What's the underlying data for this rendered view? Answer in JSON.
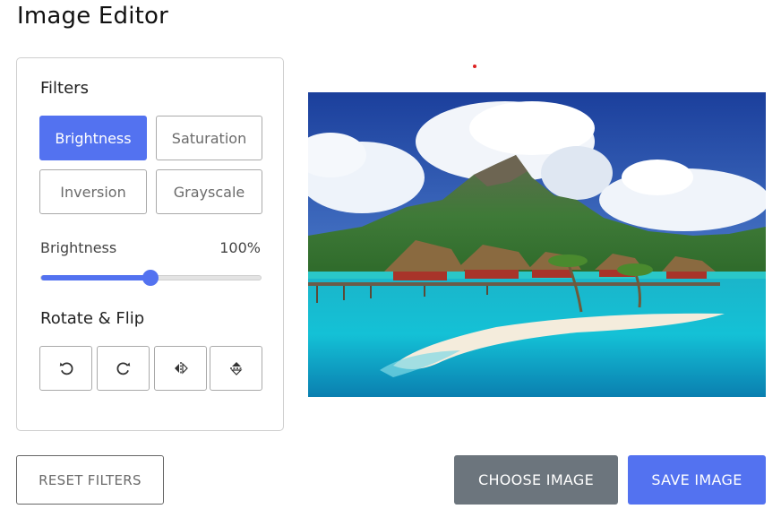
{
  "app": {
    "title": "Image Editor"
  },
  "filters": {
    "heading": "Filters",
    "buttons": [
      {
        "label": "Brightness",
        "active": true
      },
      {
        "label": "Saturation",
        "active": false
      },
      {
        "label": "Inversion",
        "active": false
      },
      {
        "label": "Grayscale",
        "active": false
      }
    ]
  },
  "slider": {
    "name": "Brightness",
    "value_text": "100%",
    "fraction": 0.5
  },
  "rotate": {
    "heading": "Rotate & Flip",
    "buttons": [
      {
        "icon": "rotate-left-icon"
      },
      {
        "icon": "rotate-right-icon"
      },
      {
        "icon": "flip-horizontal-icon"
      },
      {
        "icon": "flip-vertical-icon"
      }
    ]
  },
  "actions": {
    "reset_label": "RESET FILTERS",
    "choose_label": "CHOOSE IMAGE",
    "save_label": "SAVE IMAGE"
  },
  "colors": {
    "accent": "#5372f0",
    "secondary": "#6c757d"
  }
}
